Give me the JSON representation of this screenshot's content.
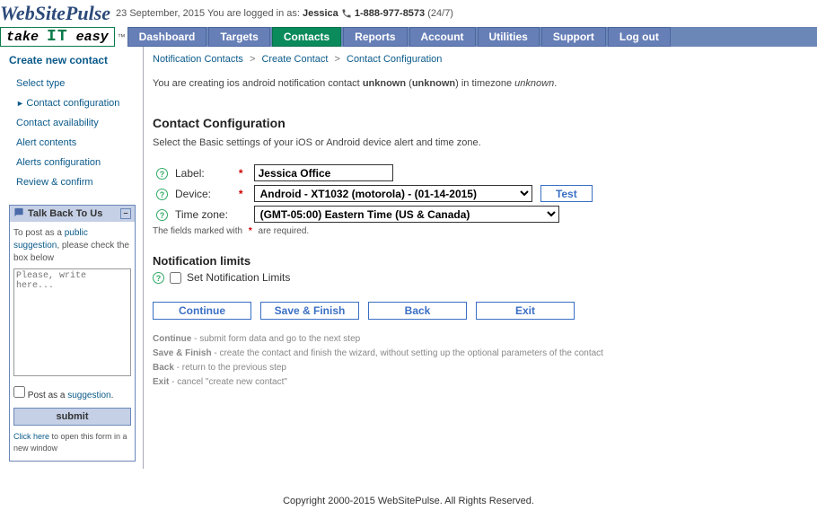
{
  "header": {
    "logo": "WebSitePulse",
    "tagline_take": "take",
    "tagline_it": "IT",
    "tagline_easy": "easy",
    "date": "23 September, 2015",
    "logged_pre": "You are logged in as:",
    "username": "Jessica",
    "phone": "1-888-977-8573",
    "phone_note": "(24/7)"
  },
  "nav": [
    {
      "label": "Dashboard",
      "active": false
    },
    {
      "label": "Targets",
      "active": false
    },
    {
      "label": "Contacts",
      "active": true
    },
    {
      "label": "Reports",
      "active": false
    },
    {
      "label": "Account",
      "active": false
    },
    {
      "label": "Utilities",
      "active": false
    },
    {
      "label": "Support",
      "active": false
    },
    {
      "label": "Log out",
      "active": false
    }
  ],
  "sidebar": {
    "heading": "Create new contact",
    "steps": [
      {
        "label": "Select type",
        "current": false
      },
      {
        "label": "Contact configuration",
        "current": true
      },
      {
        "label": "Contact availability",
        "current": false
      },
      {
        "label": "Alert contents",
        "current": false
      },
      {
        "label": "Alerts configuration",
        "current": false
      },
      {
        "label": "Review & confirm",
        "current": false
      }
    ],
    "talkback": {
      "title": "Talk Back To Us",
      "intro_pre": "To post as a ",
      "intro_link": "public suggestion",
      "intro_post": ", please check the box below",
      "placeholder": "Please, write here...",
      "check_pre": "Post as a ",
      "check_link": "suggestion",
      "submit": "submit",
      "foot_link": "Click here",
      "foot_post": " to open this form in a new window"
    }
  },
  "breadcrumb": [
    "Notification Contacts",
    "Create Contact",
    "Contact Configuration"
  ],
  "intro": {
    "pre": "You are creating ios android notification contact ",
    "b1": "unknown",
    "par_open": " (",
    "b2": "unknown",
    "par_close": ")",
    "mid": " in timezone ",
    "i1": "unknown",
    "end": "."
  },
  "section": {
    "title": "Contact Configuration",
    "desc": "Select the Basic settings of your iOS or Android device alert and time zone."
  },
  "form": {
    "label_label": "Label:",
    "label_value": "Jessica Office",
    "device_label": "Device:",
    "device_value": "Android - XT1032 (motorola) - (01-14-2015)",
    "test_btn": "Test",
    "tz_label": "Time zone:",
    "tz_value": "(GMT-05:00) Eastern Time (US & Canada)",
    "req_note_pre": "The fields marked with ",
    "req_note_post": " are required."
  },
  "notif": {
    "title": "Notification limits",
    "check_label": "Set Notification Limits"
  },
  "buttons": {
    "continue": "Continue",
    "save": "Save & Finish",
    "back": "Back",
    "exit": "Exit"
  },
  "explain": {
    "l1b": "Continue",
    "l1": " - submit form data and go to the next step",
    "l2b": "Save & Finish",
    "l2": " - create the contact and finish the wizard, without setting up the optional parameters of the contact",
    "l3b": "Back",
    "l3": " - return to the previous step",
    "l4b": "Exit",
    "l4": " - cancel \"create new contact\""
  },
  "footer": "Copyright 2000-2015 WebSitePulse. All Rights Reserved."
}
